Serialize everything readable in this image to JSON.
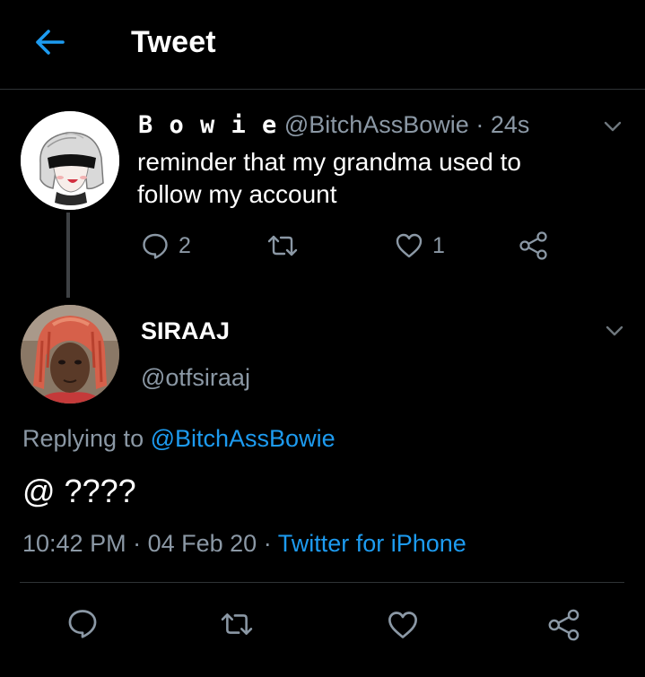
{
  "header": {
    "title": "Tweet"
  },
  "parent_tweet": {
    "display_name": "B o w i e",
    "handle": "@BitchAssBowie",
    "separator": "·",
    "time": "24s",
    "text_line1": "reminder that my grandma used to",
    "text_line2": "follow my account",
    "replies": "2",
    "likes": "1"
  },
  "main_tweet": {
    "display_name": "SIRAAJ",
    "handle": "@otfsiraaj",
    "replying_prefix": "Replying to",
    "replying_to": "@BitchAssBowie",
    "text": "@ ????",
    "time": "10:42 PM",
    "dot1": "·",
    "date": "04 Feb 20",
    "dot2": "·",
    "source": "Twitter for iPhone"
  },
  "colors": {
    "background": "#000000",
    "accent": "#1d9bf0",
    "muted": "#8b98a5"
  },
  "icons": {
    "back": "arrow-left-icon",
    "more": "chevron-down-icon",
    "reply": "reply-bubble-icon",
    "retweet": "retweet-icon",
    "like": "heart-icon",
    "share": "share-icon"
  }
}
